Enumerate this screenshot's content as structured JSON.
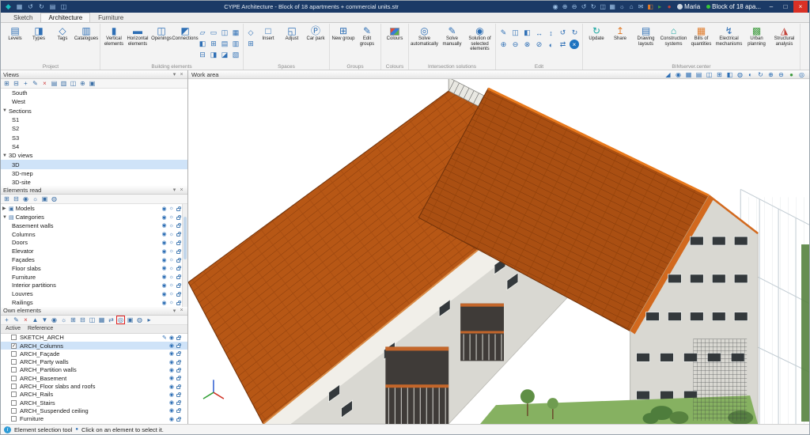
{
  "titlebar": {
    "title": "CYPE Architecture - Block of 18 apartments + commercial units.str",
    "user": "Maria",
    "project": "Block of 18 apa...",
    "left_icons": [
      "◆",
      "▦",
      "↺",
      "↻",
      "▤",
      "◫"
    ],
    "right_icons": [
      "◉",
      "⊕",
      "⊖",
      "↺",
      "↻",
      "◫",
      "▦",
      "☼",
      "⌂",
      "✉",
      "◧",
      "▸",
      "●"
    ],
    "window": {
      "minimize": "–",
      "maximize": "□",
      "close": "×"
    }
  },
  "tabs": {
    "items": [
      {
        "label": "Sketch"
      },
      {
        "label": "Architecture"
      },
      {
        "label": "Furniture"
      }
    ]
  },
  "ribbon": {
    "project": {
      "label": "Project",
      "buttons": [
        {
          "label": "Levels",
          "glyph": "▤"
        },
        {
          "label": "Types",
          "glyph": "◨"
        },
        {
          "label": "Tags",
          "glyph": "◇"
        },
        {
          "label": "Catalogues",
          "glyph": "▥"
        }
      ]
    },
    "building": {
      "label": "Building elements",
      "buttons": [
        {
          "label": "Vertical elements",
          "glyph": "▮"
        },
        {
          "label": "Horizontal elements",
          "glyph": "▬"
        },
        {
          "label": "Openings",
          "glyph": "◫"
        },
        {
          "label": "Connections",
          "glyph": "◩"
        }
      ],
      "grid": [
        "▱",
        "▭",
        "◫",
        "▦",
        "◧",
        "⊞",
        "▤",
        "▥",
        "⊟",
        "◨",
        "◪",
        "▧"
      ]
    },
    "spaces": {
      "label": "Spaces",
      "small": [
        "◇",
        "⊞"
      ],
      "buttons": [
        {
          "label": "Insert",
          "glyph": "□"
        },
        {
          "label": "Adjust",
          "glyph": "◱"
        },
        {
          "label": "Car park",
          "glyph": "Ⓟ"
        }
      ]
    },
    "groups": {
      "label": "Groups",
      "buttons": [
        {
          "label": "New group",
          "glyph": "⊞"
        },
        {
          "label": "Edit groups",
          "glyph": "✎"
        }
      ]
    },
    "colours": {
      "label": "Colours",
      "buttons": [
        {
          "label": "Colours"
        }
      ]
    },
    "intersections": {
      "label": "Intersection solutions",
      "buttons": [
        {
          "label": "Solve automatically",
          "glyph": "◎"
        },
        {
          "label": "Solve manually",
          "glyph": "✎"
        },
        {
          "label": "Solution of selected elements",
          "glyph": "◉"
        }
      ]
    },
    "edit": {
      "label": "Edit",
      "grid": [
        "✎",
        "◫",
        "◧",
        "↔",
        "↕",
        "↺",
        "↻",
        "⊕",
        "⊖",
        "⊗",
        "⊘",
        "◐",
        "⇄"
      ],
      "cancel": "×"
    },
    "bimserver": {
      "label": "BIMserver.center",
      "update": {
        "label": "Update",
        "glyph": "↻"
      },
      "share": {
        "label": "Share",
        "glyph": "↥"
      },
      "buttons": [
        {
          "label": "Drawing layouts",
          "glyph": "▤"
        },
        {
          "label": "Construction systems",
          "glyph": "⌂"
        },
        {
          "label": "Bills of quantities",
          "glyph": "▦"
        },
        {
          "label": "Electrical mechanisms",
          "glyph": "↯"
        },
        {
          "label": "Urban planning",
          "glyph": "▩"
        },
        {
          "label": "Structural analysis",
          "glyph": "◮"
        }
      ]
    }
  },
  "panel_header": {
    "pin": "▾",
    "close": "×"
  },
  "views_panel": {
    "title": "Views",
    "toolbar": [
      "⊞",
      "⊟",
      "+",
      "✎",
      "×",
      "▤",
      "▥",
      "◫",
      "⊕",
      "▣"
    ],
    "items": [
      {
        "label": "South"
      },
      {
        "label": "West"
      },
      {
        "label": "Sections",
        "exp": "▼"
      },
      {
        "label": "S1"
      },
      {
        "label": "S2"
      },
      {
        "label": "S3"
      },
      {
        "label": "S4"
      },
      {
        "label": "3D views",
        "exp": "▼"
      },
      {
        "label": "3D"
      },
      {
        "label": "3D-mep"
      },
      {
        "label": "3D-site"
      }
    ]
  },
  "elements_read": {
    "title": "Elements read",
    "toolbar": [
      "⊞",
      "⊟",
      "◉",
      "☼",
      "▣",
      "◍"
    ],
    "items": [
      {
        "label": "Models",
        "exp": "▶",
        "icon": "▣"
      },
      {
        "label": "Categories",
        "exp": "▼",
        "icon": "▤"
      },
      {
        "label": "Basement walls"
      },
      {
        "label": "Columns"
      },
      {
        "label": "Doors"
      },
      {
        "label": "Elevator"
      },
      {
        "label": "Façades"
      },
      {
        "label": "Floor slabs"
      },
      {
        "label": "Furniture"
      },
      {
        "label": "Interior partitions"
      },
      {
        "label": "Louvres"
      },
      {
        "label": "Railings"
      }
    ]
  },
  "own_elements": {
    "title": "Own elements",
    "toolbar": [
      "+",
      "✎",
      "×",
      "▲",
      "▼",
      "◉",
      "☼",
      "⊞",
      "⊟",
      "◫",
      "▦",
      "⇄",
      "◎",
      "▣",
      "◍",
      "▸"
    ],
    "columns": {
      "active": "Active",
      "reference": "Reference"
    },
    "rows": [
      {
        "reference": "SKETCH_ARCH",
        "checked": false
      },
      {
        "reference": "ARCH_Columns",
        "checked": true
      },
      {
        "reference": "ARCH_Façade",
        "checked": false
      },
      {
        "reference": "ARCH_Party walls",
        "checked": false
      },
      {
        "reference": "ARCH_Partition walls",
        "checked": false
      },
      {
        "reference": "ARCH_Basement",
        "checked": false
      },
      {
        "reference": "ARCH_Floor slabs and roofs",
        "checked": false
      },
      {
        "reference": "ARCH_Rails",
        "checked": false
      },
      {
        "reference": "ARCH_Stairs",
        "checked": false
      },
      {
        "reference": "ARCH_Suspended ceiling",
        "checked": false
      },
      {
        "reference": "Furniture",
        "checked": false
      }
    ]
  },
  "work_area": {
    "title": "Work area",
    "icons": [
      "◢",
      "◉",
      "▦",
      "▤",
      "◫",
      "⊞",
      "◧",
      "◍",
      "◐",
      "↻",
      "⊕",
      "⊖",
      "●",
      "◎"
    ]
  },
  "statusbar": {
    "tool": "Element selection tool",
    "bullet": "●",
    "hint": "Click on an element to select it."
  },
  "scene": {
    "roof_left": "#b75715",
    "roof_right": "#aa4f12",
    "trim": "#d2691e",
    "wall": "#d9d8d2",
    "wall_light": "#f1efe9",
    "window": "#34393c",
    "ground": "#86b161",
    "axis_x": "#cf2e21",
    "axis_y": "#2f9e33",
    "axis_z": "#2d5bd1"
  }
}
